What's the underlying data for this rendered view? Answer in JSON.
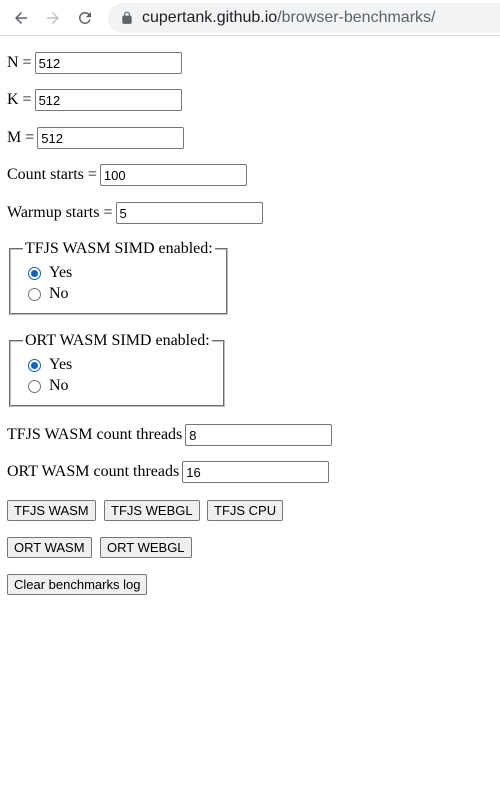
{
  "browser": {
    "url_host": "cupertank.github.io",
    "url_path": "/browser-benchmarks/"
  },
  "form": {
    "n": {
      "label": "N =",
      "value": "512"
    },
    "k": {
      "label": "K =",
      "value": "512"
    },
    "m": {
      "label": "M =",
      "value": "512"
    },
    "count_starts": {
      "label": "Count starts =",
      "value": "100"
    },
    "warmup_starts": {
      "label": "Warmup starts =",
      "value": "5"
    },
    "tfjs_simd": {
      "legend": "TFJS WASM SIMD enabled:",
      "yes": "Yes",
      "no": "No",
      "selected": "Yes"
    },
    "ort_simd": {
      "legend": "ORT WASM SIMD enabled:",
      "yes": "Yes",
      "no": "No",
      "selected": "Yes"
    },
    "tfjs_threads": {
      "label": "TFJS WASM count threads",
      "value": "8"
    },
    "ort_threads": {
      "label": "ORT WASM count threads",
      "value": "16"
    }
  },
  "buttons": {
    "tfjs_wasm": "TFJS WASM",
    "tfjs_webgl": "TFJS WEBGL",
    "tfjs_cpu": "TFJS CPU",
    "ort_wasm": "ORT WASM",
    "ort_webgl": "ORT WEBGL",
    "clear_log": "Clear benchmarks log"
  },
  "icons": {
    "back": "arrow-left-icon",
    "forward": "arrow-right-icon",
    "reload": "reload-icon",
    "lock": "lock-icon"
  },
  "colors": {
    "radio_accent": "#0b62c9",
    "omnibox_bg": "#f1f3f4"
  }
}
